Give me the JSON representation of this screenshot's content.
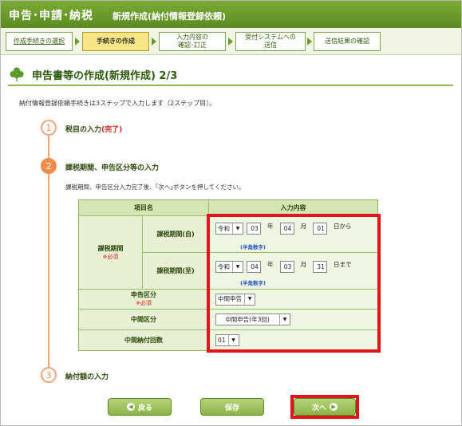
{
  "header": {
    "app_title": "申告･申請･納税",
    "subtitle": "新規作成(納付情報登録依頼)"
  },
  "steps": [
    {
      "label": "作成手続きの選択",
      "state": "done"
    },
    {
      "label": "手続きの作成",
      "state": "active"
    },
    {
      "label": "入力内容の\n確認･訂正",
      "state": "pending"
    },
    {
      "label": "受付システムへの\n送信",
      "state": "pending"
    },
    {
      "label": "送信結果の確認",
      "state": "pending"
    }
  ],
  "section_title": "申告書等の作成(新規作成) 2/3",
  "intro": "納付情報登録依頼手続きは3ステップで入力します（2ステップ目）。",
  "stages": [
    {
      "num": "1",
      "title": "税目の入力",
      "tag": "(完了)"
    },
    {
      "num": "2",
      "title": "課税期間、申告区分等の入力",
      "desc": "課税期間、申告区分入力完了後、｢次へ｣ボタンを押してください。"
    },
    {
      "num": "3",
      "title": "納付額の入力"
    }
  ],
  "table": {
    "col_headers": [
      "項目名",
      "入力内容"
    ],
    "group_label": "課税期間",
    "required_mark": "※必須",
    "period_from": {
      "label": "課税期間(自)",
      "era": "令和",
      "year": "03",
      "month": "04",
      "day": "01",
      "year_label": "年",
      "month_label": "月",
      "suffix": "日から",
      "note": "(半角数字)"
    },
    "period_to": {
      "label": "課税期間(至)",
      "era": "令和",
      "year": "04",
      "month": "03",
      "day": "31",
      "year_label": "年",
      "month_label": "月",
      "suffix": "日まで",
      "note": "(半角数字)"
    },
    "declaration_type": {
      "label": "申告区分",
      "value": "中間申告"
    },
    "interim_type": {
      "label": "中間区分",
      "value": "中間申告(年3回)"
    },
    "interim_count": {
      "label": "中間納付回数",
      "value": "01"
    }
  },
  "buttons": {
    "back": "戻る",
    "save": "保存",
    "next": "次へ"
  },
  "colors": {
    "brand_green": "#6b9a2c",
    "highlight_red": "#e0141a",
    "step_orange": "#f18c4a"
  }
}
